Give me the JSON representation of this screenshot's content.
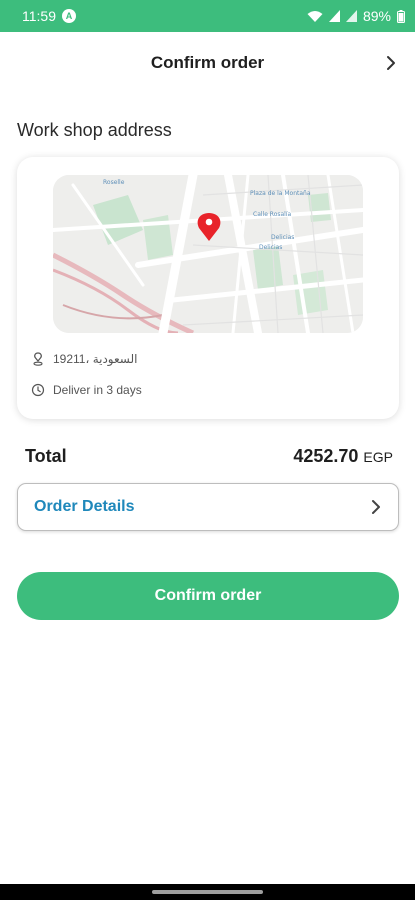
{
  "status_bar": {
    "time": "11:59",
    "badge": "A",
    "battery": "89%",
    "icons": [
      "wifi-icon",
      "signal-icon",
      "signal-icon",
      "battery-icon"
    ]
  },
  "header": {
    "title": "Confirm order",
    "arrow_icon": "chevron-right-icon"
  },
  "section": {
    "title": "Work shop address"
  },
  "address_card": {
    "map_labels": [
      "Roselle",
      "Plaza de la Montaña",
      "Calle Rosalía",
      "Delicias",
      "Delicias"
    ],
    "address": "19211، السعودية",
    "address_icon": "location-pin-icon",
    "delivery": "Deliver in 3 days",
    "delivery_icon": "clock-icon"
  },
  "total": {
    "label": "Total",
    "amount": "4252.70",
    "currency": "EGP"
  },
  "order_details": {
    "label": "Order Details",
    "arrow_icon": "chevron-right-icon"
  },
  "confirm_button": {
    "label": "Confirm order"
  },
  "colors": {
    "accent": "#3dbd7d",
    "link": "#1f88bb",
    "marker": "#e8232a"
  }
}
